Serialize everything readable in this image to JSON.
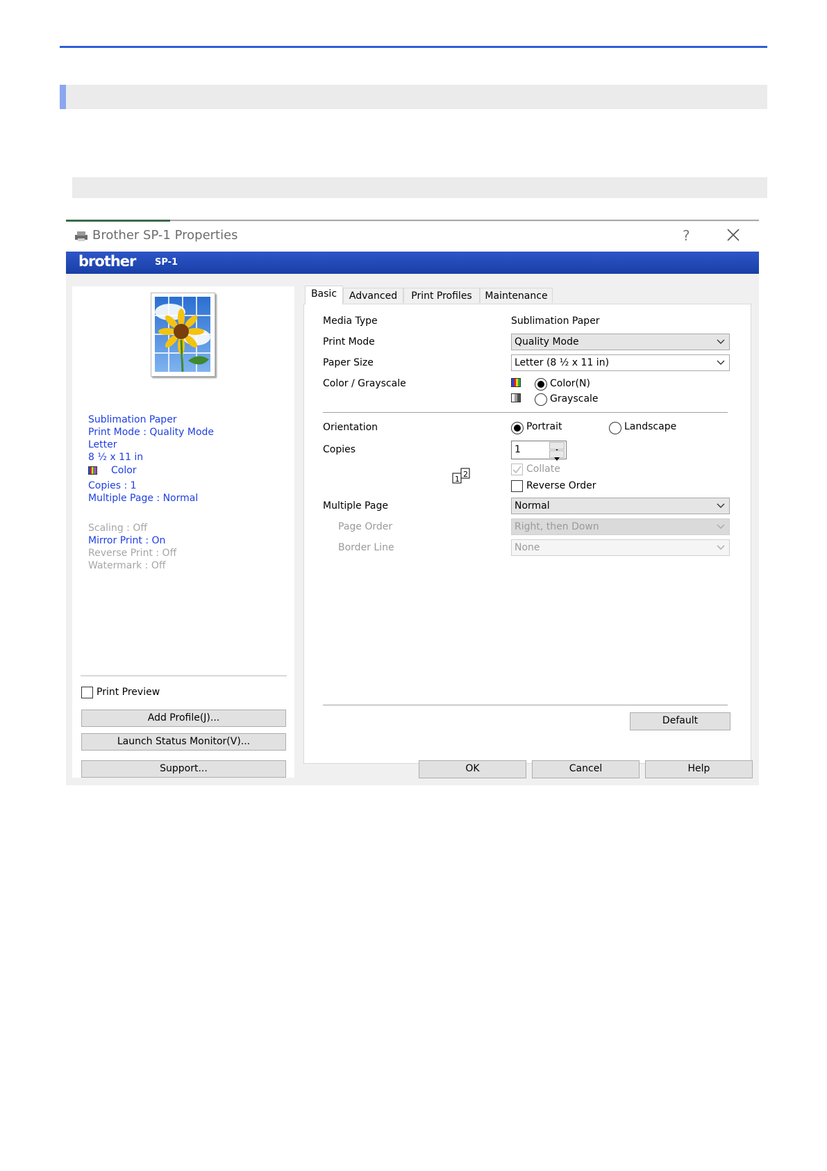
{
  "window": {
    "title": "Brother SP-1 Properties",
    "help_glyph": "?",
    "brand": "brother",
    "model": "SP-1"
  },
  "summary": {
    "lines": [
      "Sublimation Paper",
      "Print Mode : Quality Mode",
      "Letter",
      "8 ½ x 11 in",
      "Color",
      "Copies : 1",
      "Multiple Page : Normal",
      "Scaling : Off",
      "Mirror Print : On",
      "Reverse Print : Off",
      "Watermark : Off"
    ]
  },
  "left": {
    "print_preview_label": "Print Preview",
    "add_profile_label": "Add Profile(J)...",
    "launch_status_label": "Launch Status Monitor(V)...",
    "support_label": "Support..."
  },
  "tabs": [
    "Basic",
    "Advanced",
    "Print Profiles",
    "Maintenance"
  ],
  "basic": {
    "media_type_label": "Media Type",
    "media_type_value": "Sublimation Paper",
    "print_mode_label": "Print Mode",
    "print_mode_value": "Quality Mode",
    "paper_size_label": "Paper Size",
    "paper_size_value": "Letter (8 ½ x 11 in)",
    "color_label": "Color / Grayscale",
    "color_option": "Color(N)",
    "grayscale_option": "Grayscale",
    "orientation_label": "Orientation",
    "portrait_option": "Portrait",
    "landscape_option": "Landscape",
    "copies_label": "Copies",
    "copies_value": "1",
    "collate_label": "Collate",
    "reverse_order_label": "Reverse Order",
    "multiple_page_label": "Multiple Page",
    "multiple_page_value": "Normal",
    "page_order_label": "Page Order",
    "page_order_value": "Right, then Down",
    "border_line_label": "Border Line",
    "border_line_value": "None",
    "default_label": "Default"
  },
  "footer": {
    "ok_label": "OK",
    "cancel_label": "Cancel",
    "help_label": "Help"
  }
}
